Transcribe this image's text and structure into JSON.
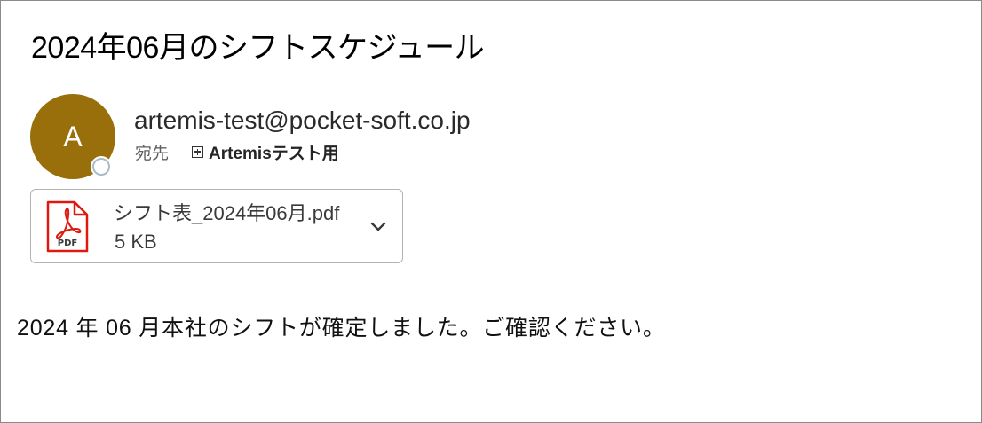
{
  "message": {
    "subject": "2024年06月のシフトスケジュール",
    "sender": {
      "avatar_initial": "A",
      "avatar_color": "#986f0b",
      "address": "artemis-test@pocket-soft.co.jp",
      "presence_status": "offline"
    },
    "to": {
      "label": "宛先",
      "recipient": "Artemisテスト用",
      "expand_icon": "plus-box-icon"
    },
    "attachment": {
      "file_icon": "pdf-icon",
      "file_icon_label": "PDF",
      "file_name": "シフト表_2024年06月.pdf",
      "file_size": "5 KB",
      "menu_icon": "chevron-down-icon"
    },
    "body": "2024 年 06 月本社のシフトが確定しました。ご確認ください。"
  },
  "colors": {
    "pdf_red": "#e0190f",
    "presence_ring": "#a9bcc6",
    "border": "#b3b3b3"
  }
}
